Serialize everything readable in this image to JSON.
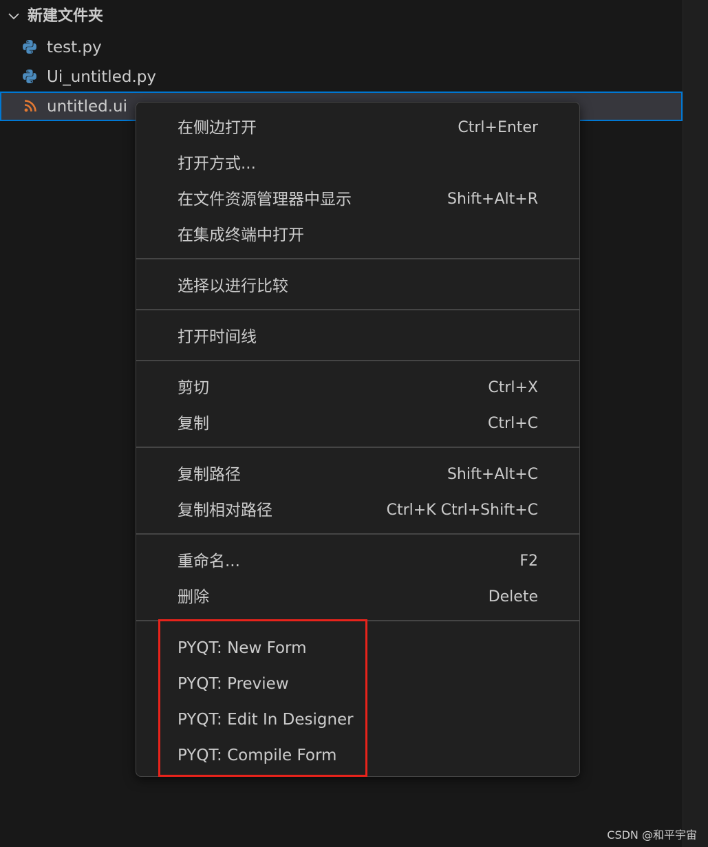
{
  "explorer": {
    "folder": {
      "name": "新建文件夹",
      "expanded_icon": "chevron-down-icon"
    },
    "files": [
      {
        "name": "test.py",
        "icon": "python-file-icon"
      },
      {
        "name": "Ui_untitled.py",
        "icon": "python-file-icon"
      },
      {
        "name": "untitled.ui",
        "icon": "rss-file-icon",
        "selected": true
      }
    ]
  },
  "context_menu": {
    "groups": [
      {
        "items": [
          {
            "label": "在侧边打开",
            "shortcut": "Ctrl+Enter"
          },
          {
            "label": "打开方式...",
            "shortcut": ""
          },
          {
            "label": "在文件资源管理器中显示",
            "shortcut": "Shift+Alt+R"
          },
          {
            "label": "在集成终端中打开",
            "shortcut": ""
          }
        ]
      },
      {
        "items": [
          {
            "label": "选择以进行比较",
            "shortcut": ""
          }
        ]
      },
      {
        "items": [
          {
            "label": "打开时间线",
            "shortcut": ""
          }
        ]
      },
      {
        "items": [
          {
            "label": "剪切",
            "shortcut": "Ctrl+X"
          },
          {
            "label": "复制",
            "shortcut": "Ctrl+C"
          }
        ]
      },
      {
        "items": [
          {
            "label": "复制路径",
            "shortcut": "Shift+Alt+C"
          },
          {
            "label": "复制相对路径",
            "shortcut": "Ctrl+K Ctrl+Shift+C"
          }
        ]
      },
      {
        "items": [
          {
            "label": "重命名...",
            "shortcut": "F2"
          },
          {
            "label": "删除",
            "shortcut": "Delete"
          }
        ]
      },
      {
        "items": [
          {
            "label": "PYQT: New Form",
            "shortcut": ""
          },
          {
            "label": "PYQT: Preview",
            "shortcut": ""
          },
          {
            "label": "PYQT: Edit In Designer",
            "shortcut": ""
          },
          {
            "label": "PYQT: Compile Form",
            "shortcut": ""
          }
        ]
      }
    ]
  },
  "annotation": {
    "highlight_color": "#e8231b"
  },
  "colors": {
    "background": "#181818",
    "menu_background": "#202020",
    "selection_border": "#0078d4",
    "selection_background": "#37373d",
    "python_icon": "#4b8bbe",
    "rss_icon": "#e37933"
  },
  "watermark": "CSDN @和平宇宙"
}
